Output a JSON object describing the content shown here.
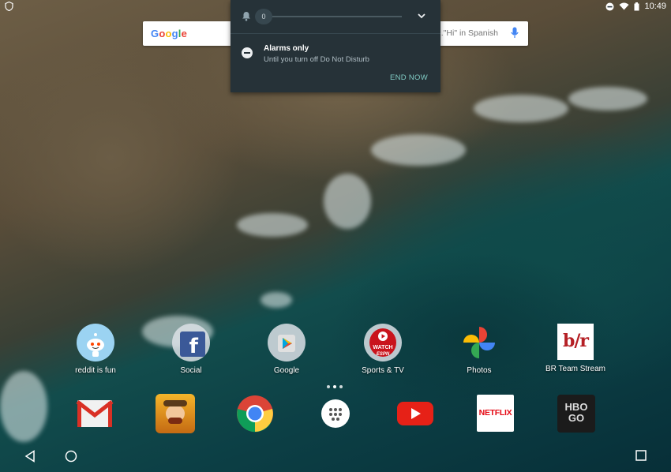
{
  "statusbar": {
    "left_icon": "shield-icon",
    "icons": [
      "dnd-icon",
      "wifi-icon",
      "battery-icon"
    ],
    "time": "10:49"
  },
  "search": {
    "logo": "Google",
    "hint": "...\"Hi\" in Spanish",
    "mic_icon": "mic-icon"
  },
  "dnd_panel": {
    "bell_icon": "bell-icon",
    "slider_value": "0",
    "chevron_icon": "chevron-down-icon",
    "title": "Alarms only",
    "subtitle": "Until you turn off Do Not Disturb",
    "end_button": "END NOW"
  },
  "apps": [
    {
      "label": "reddit is fun",
      "icon": "reddit-icon"
    },
    {
      "label": "Social",
      "icon": "social-folder-icon"
    },
    {
      "label": "Google",
      "icon": "google-folder-icon"
    },
    {
      "label": "Sports & TV",
      "icon": "watch-espn-icon"
    },
    {
      "label": "Photos",
      "icon": "photos-icon"
    },
    {
      "label": "BR Team Stream",
      "icon": "br-icon"
    }
  ],
  "dock": [
    {
      "icon": "gmail-icon"
    },
    {
      "icon": "clash-of-clans-icon"
    },
    {
      "icon": "chrome-icon"
    },
    {
      "icon": "app-drawer-icon"
    },
    {
      "icon": "youtube-icon"
    },
    {
      "icon": "netflix-icon",
      "text": "NETFLIX"
    },
    {
      "icon": "hbo-go-icon",
      "text": "HBO GO"
    }
  ],
  "icon_text": {
    "watch": "WATCH",
    "espn": "ESPN",
    "br": "b/r"
  },
  "navbar": [
    "back-icon",
    "home-icon",
    "recents-icon"
  ]
}
